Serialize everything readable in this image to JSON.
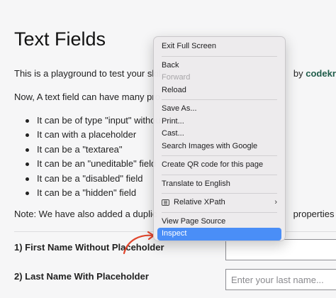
{
  "page": {
    "title": "Text Fields",
    "intro_visible_start": "This is a playground to test your skil",
    "intro_visible_end": "by",
    "brand": "codekru",
    "para2_visible": "Now, A text field can have many pro",
    "bullets": [
      "It can be of type \"input\" withou",
      "It can with a placeholder",
      "It can be a \"textarea\"",
      "It can be an \"uneditable\" field",
      "It can be a \"disabled\" field",
      "It can be a \"hidden\" field"
    ],
    "note_visible_start": "Note: We have also added a duplic",
    "note_visible_end": "properties as",
    "field1_label": "1) First Name Without Placeholder",
    "field1_value": "",
    "field2_label": "2) Last Name With Placeholder",
    "field2_value": "",
    "field2_placeholder": "Enter your last name..."
  },
  "context_menu": {
    "items": [
      {
        "label": "Exit Full Screen"
      },
      {
        "label": "Back"
      },
      {
        "label": "Forward",
        "disabled": true
      },
      {
        "label": "Reload"
      },
      {
        "label": "Save As..."
      },
      {
        "label": "Print..."
      },
      {
        "label": "Cast..."
      },
      {
        "label": "Search Images with Google"
      },
      {
        "label": "Create QR code for this page"
      },
      {
        "label": "Translate to English"
      },
      {
        "label": "Relative XPath",
        "icon": "xpath-extension-icon",
        "submenu": true
      },
      {
        "label": "View Page Source"
      },
      {
        "label": "Inspect",
        "highlighted": true
      }
    ],
    "chevron": "›"
  },
  "colors": {
    "brand": "#1f5c4a",
    "highlight": "#4a8ef7",
    "arrow": "#e0452c"
  }
}
